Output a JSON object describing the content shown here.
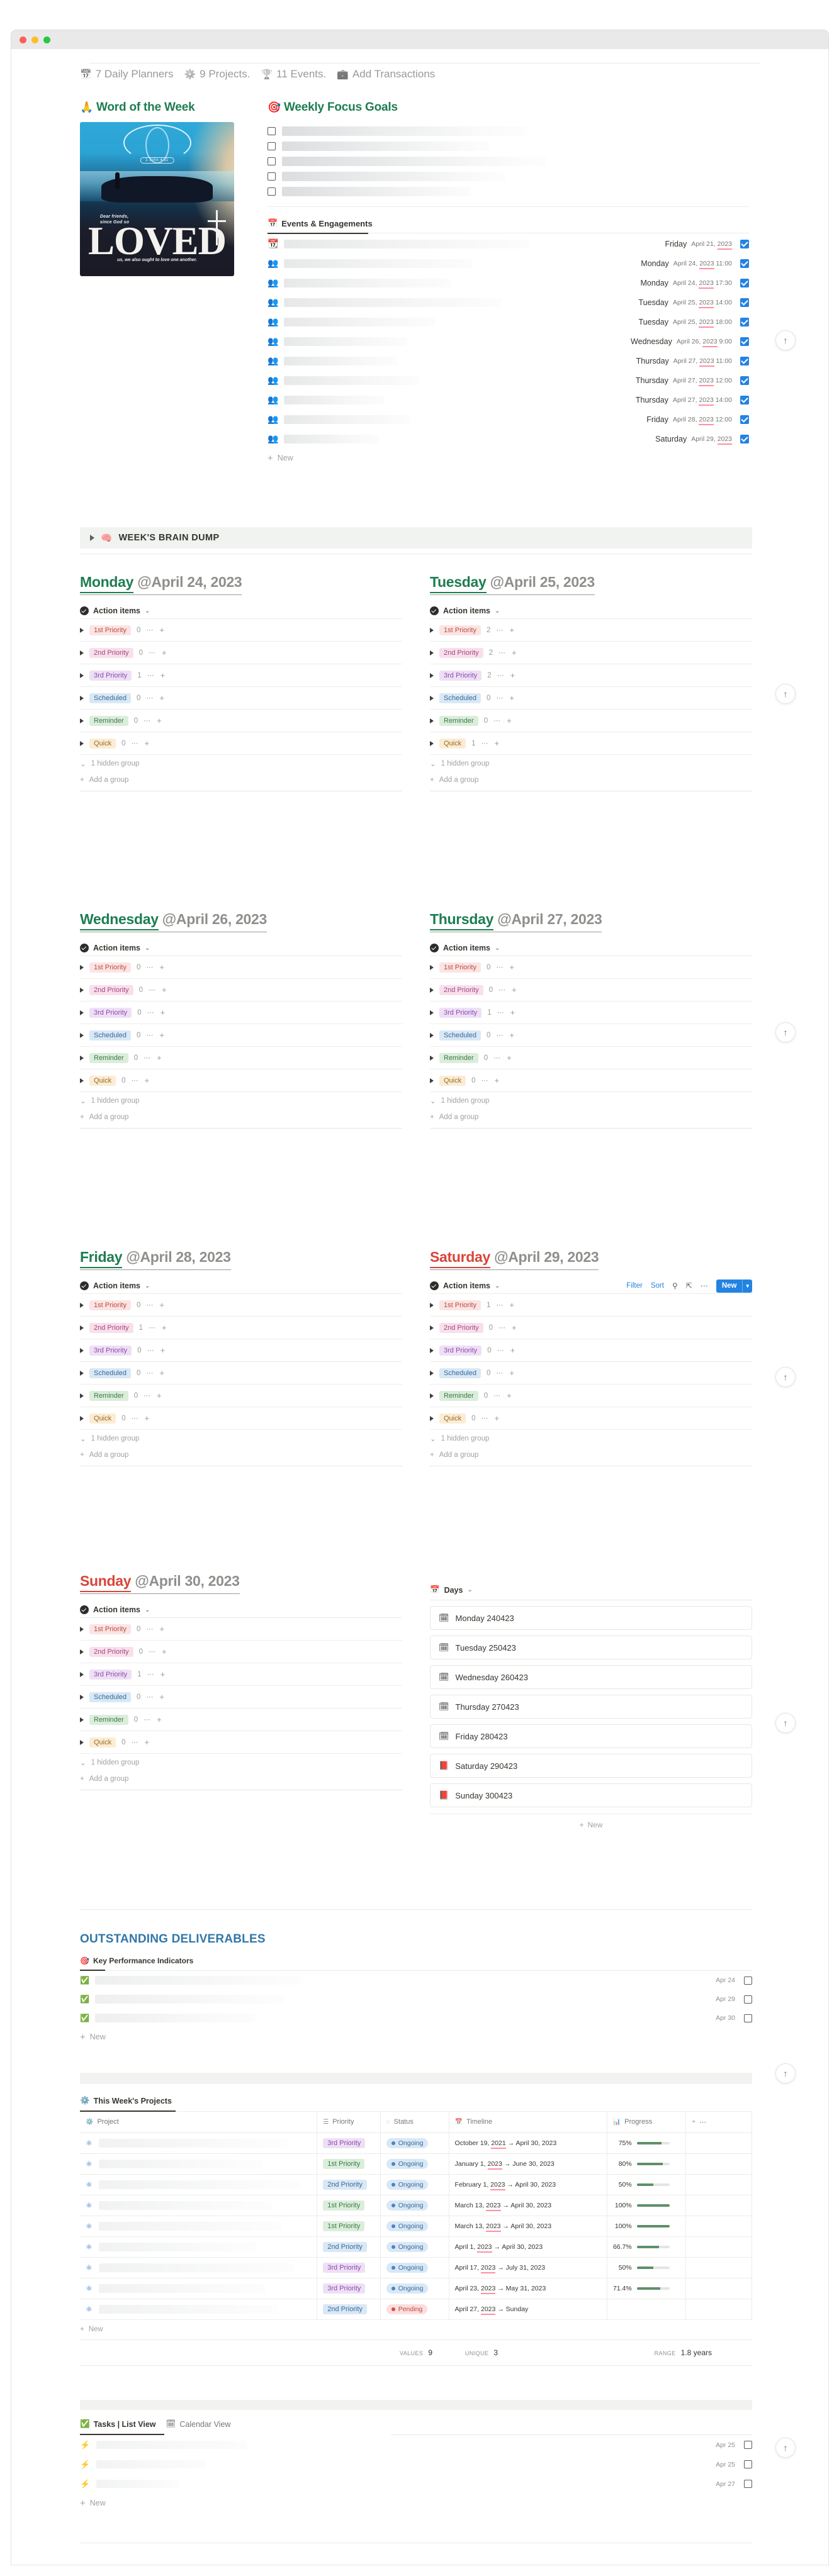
{
  "window": {
    "traffic_lights": [
      "close",
      "minimize",
      "zoom"
    ]
  },
  "breadcrumb": [
    {
      "icon": "calendar-icon",
      "glyph": "📅",
      "label": "7 Daily Planners"
    },
    {
      "icon": "gear-icon",
      "glyph": "⚙️",
      "label": "9 Projects."
    },
    {
      "icon": "trophy-icon",
      "glyph": "🏆",
      "label": "11 Events."
    },
    {
      "icon": "briefcase-icon",
      "glyph": "💼",
      "label": "Add Transactions"
    }
  ],
  "word_of_week": {
    "heading": "Word of the Week",
    "heading_emoji": "🙏",
    "poster": {
      "main_word": "LOVED",
      "top_text": "Dear friends,\nsince God so",
      "bottom_text": "us, we also ought to love one another.",
      "verse_ref": "1 John 4:11"
    }
  },
  "weekly_focus_goals": {
    "heading": "Weekly Focus Goals",
    "heading_emoji": "🎯",
    "rows": [
      {
        "checked": false,
        "redacted_class": "r-g1"
      },
      {
        "checked": false,
        "redacted_class": "r-g2"
      },
      {
        "checked": false,
        "redacted_class": "r-g3"
      },
      {
        "checked": false,
        "redacted_class": "r-g4"
      },
      {
        "checked": false,
        "redacted_class": "r-g5"
      }
    ]
  },
  "events": {
    "tab_label": "Events & Engagements",
    "tab_emoji": "📅",
    "new_label": "New",
    "rows": [
      {
        "icon_emoji": "📆",
        "day": "Friday",
        "date": "April 21, ",
        "year": "2023",
        "time": "",
        "checked": true,
        "rw": 390
      },
      {
        "icon_emoji": "👥",
        "day": "Monday",
        "date": "April 24, ",
        "year": "2023",
        "time": " 11:00",
        "checked": true,
        "rw": 300
      },
      {
        "icon_emoji": "👥",
        "day": "Monday",
        "date": "April 24, ",
        "year": "2023",
        "time": " 17:30",
        "checked": true,
        "rw": 265
      },
      {
        "icon_emoji": "👥",
        "day": "Tuesday",
        "date": "April 25, ",
        "year": "2023",
        "time": " 14:00",
        "checked": true,
        "rw": 345
      },
      {
        "icon_emoji": "👥",
        "day": "Tuesday",
        "date": "April 25, ",
        "year": "2023",
        "time": " 18:00",
        "checked": true,
        "rw": 240
      },
      {
        "icon_emoji": "👥",
        "day": "Wednesday",
        "date": "April 26, ",
        "year": "2023",
        "time": " 9:00",
        "checked": true,
        "rw": 195
      },
      {
        "icon_emoji": "👥",
        "day": "Thursday",
        "date": "April 27, ",
        "year": "2023",
        "time": " 11:00",
        "checked": true,
        "rw": 180
      },
      {
        "icon_emoji": "👥",
        "day": "Thursday",
        "date": "April 27, ",
        "year": "2023",
        "time": " 12:00",
        "checked": true,
        "rw": 215
      },
      {
        "icon_emoji": "👥",
        "day": "Thursday",
        "date": "April 27, ",
        "year": "2023",
        "time": " 14:00",
        "checked": true,
        "rw": 160
      },
      {
        "icon_emoji": "👥",
        "day": "Friday",
        "date": "April 28, ",
        "year": "2023",
        "time": " 12:00",
        "checked": true,
        "rw": 200
      },
      {
        "icon_emoji": "👥",
        "day": "Saturday",
        "date": "April 29, ",
        "year": "2023",
        "time": "",
        "checked": true,
        "rw": 150
      }
    ]
  },
  "brain_dump": {
    "label": "WEEK'S BRAIN DUMP",
    "emoji": "🧠"
  },
  "day_labels": {
    "action_items": "Action items",
    "hidden_group": "1 hidden group",
    "add_group": "Add a group",
    "filter": "Filter",
    "sort": "Sort",
    "new": "New"
  },
  "days": [
    {
      "name": "Monday",
      "date": "@April 24, 2023",
      "weekend": false,
      "groups": [
        {
          "label": "1st Priority",
          "cls": "p-1st",
          "count": "0"
        },
        {
          "label": "2nd Priority",
          "cls": "p-2nd",
          "count": "0"
        },
        {
          "label": "3rd Priority",
          "cls": "p-3rd",
          "count": "1"
        },
        {
          "label": "Scheduled",
          "cls": "p-sch",
          "count": "0"
        },
        {
          "label": "Reminder",
          "cls": "p-rem",
          "count": "0"
        },
        {
          "label": "Quick",
          "cls": "p-qui",
          "count": "0"
        }
      ]
    },
    {
      "name": "Tuesday",
      "date": "@April 25, 2023",
      "weekend": false,
      "groups": [
        {
          "label": "1st Priority",
          "cls": "p-1st",
          "count": "2"
        },
        {
          "label": "2nd Priority",
          "cls": "p-2nd",
          "count": "2"
        },
        {
          "label": "3rd Priority",
          "cls": "p-3rd",
          "count": "2"
        },
        {
          "label": "Scheduled",
          "cls": "p-sch",
          "count": "0"
        },
        {
          "label": "Reminder",
          "cls": "p-rem",
          "count": "0"
        },
        {
          "label": "Quick",
          "cls": "p-qui",
          "count": "1"
        }
      ]
    },
    {
      "name": "Wednesday",
      "date": "@April 26, 2023",
      "weekend": false,
      "groups": [
        {
          "label": "1st Priority",
          "cls": "p-1st",
          "count": "0"
        },
        {
          "label": "2nd Priority",
          "cls": "p-2nd",
          "count": "0"
        },
        {
          "label": "3rd Priority",
          "cls": "p-3rd",
          "count": "0"
        },
        {
          "label": "Scheduled",
          "cls": "p-sch",
          "count": "0"
        },
        {
          "label": "Reminder",
          "cls": "p-rem",
          "count": "0"
        },
        {
          "label": "Quick",
          "cls": "p-qui",
          "count": "0"
        }
      ]
    },
    {
      "name": "Thursday",
      "date": "@April 27, 2023",
      "weekend": false,
      "groups": [
        {
          "label": "1st Priority",
          "cls": "p-1st",
          "count": "0"
        },
        {
          "label": "2nd Priority",
          "cls": "p-2nd",
          "count": "0"
        },
        {
          "label": "3rd Priority",
          "cls": "p-3rd",
          "count": "1"
        },
        {
          "label": "Scheduled",
          "cls": "p-sch",
          "count": "0"
        },
        {
          "label": "Reminder",
          "cls": "p-rem",
          "count": "0"
        },
        {
          "label": "Quick",
          "cls": "p-qui",
          "count": "0"
        }
      ]
    },
    {
      "name": "Friday",
      "date": "@April 28, 2023",
      "weekend": false,
      "groups": [
        {
          "label": "1st Priority",
          "cls": "p-1st",
          "count": "0"
        },
        {
          "label": "2nd Priority",
          "cls": "p-2nd",
          "count": "1"
        },
        {
          "label": "3rd Priority",
          "cls": "p-3rd",
          "count": "0"
        },
        {
          "label": "Scheduled",
          "cls": "p-sch",
          "count": "0"
        },
        {
          "label": "Reminder",
          "cls": "p-rem",
          "count": "0"
        },
        {
          "label": "Quick",
          "cls": "p-qui",
          "count": "0"
        }
      ]
    },
    {
      "name": "Saturday",
      "date": "@April 29, 2023",
      "weekend": true,
      "toolbar": true,
      "groups": [
        {
          "label": "1st Priority",
          "cls": "p-1st",
          "count": "1"
        },
        {
          "label": "2nd Priority",
          "cls": "p-2nd",
          "count": "0"
        },
        {
          "label": "3rd Priority",
          "cls": "p-3rd",
          "count": "0"
        },
        {
          "label": "Scheduled",
          "cls": "p-sch",
          "count": "0"
        },
        {
          "label": "Reminder",
          "cls": "p-rem",
          "count": "0"
        },
        {
          "label": "Quick",
          "cls": "p-qui",
          "count": "0"
        }
      ]
    },
    {
      "name": "Sunday",
      "date": "@April 30, 2023",
      "weekend": true,
      "groups": [
        {
          "label": "1st Priority",
          "cls": "p-1st",
          "count": "0"
        },
        {
          "label": "2nd Priority",
          "cls": "p-2nd",
          "count": "0"
        },
        {
          "label": "3rd Priority",
          "cls": "p-3rd",
          "count": "1"
        },
        {
          "label": "Scheduled",
          "cls": "p-sch",
          "count": "0"
        },
        {
          "label": "Reminder",
          "cls": "p-rem",
          "count": "0"
        },
        {
          "label": "Quick",
          "cls": "p-qui",
          "count": "0"
        }
      ]
    }
  ],
  "days_list": {
    "header": "Days",
    "header_emoji": "📅",
    "new_label": "New",
    "items": [
      {
        "emoji": "🗓",
        "label": "Monday 240423"
      },
      {
        "emoji": "🗓",
        "label": "Tuesday 250423"
      },
      {
        "emoji": "🗓",
        "label": "Wednesday 260423"
      },
      {
        "emoji": "🗓",
        "label": "Thursday 270423"
      },
      {
        "emoji": "🗓",
        "label": "Friday 280423"
      },
      {
        "emoji": "📕",
        "label": "Saturday 290423"
      },
      {
        "emoji": "📕",
        "label": "Sunday 300423"
      }
    ]
  },
  "outstanding": {
    "title": "OUTSTANDING DELIVERABLES",
    "tab_label": "Key Performance Indicators",
    "tab_emoji": "🎯",
    "new_label": "New",
    "rows": [
      {
        "date": "Apr 24",
        "rw": 330
      },
      {
        "date": "Apr 29",
        "rw": 300
      },
      {
        "date": "Apr 30",
        "rw": 255
      }
    ]
  },
  "projects": {
    "tab_label": "This Week's Projects",
    "tab_emoji": "⚙️",
    "new_label": "New",
    "columns": [
      "Project",
      "Priority",
      "Status",
      "Timeline",
      "Progress"
    ],
    "column_icons": [
      "gear-icon",
      "bars-icon",
      "loading-icon",
      "calendar-icon",
      "chart-icon"
    ],
    "rows": [
      {
        "rw": 300,
        "priority": "3rd Priority",
        "pcls": "p-3rd",
        "status": "Ongoing",
        "scls": "st-ongoing",
        "t_pre": "October 19, ",
        "t_year": "2021",
        "t_post": " → April 30, 2023",
        "progress": "75%",
        "pct": 75
      },
      {
        "rw": 260,
        "priority": "1st Priority",
        "pcls": "p-1stg",
        "status": "Ongoing",
        "scls": "st-ongoing",
        "t_pre": "January 1, ",
        "t_year": "2023",
        "t_post": " → June 30, 2023",
        "progress": "80%",
        "pct": 80
      },
      {
        "rw": 320,
        "priority": "2nd Priority",
        "pcls": "p-sch",
        "status": "Ongoing",
        "scls": "st-ongoing",
        "t_pre": "February 1, ",
        "t_year": "2023",
        "t_post": " → April 30, 2023",
        "progress": "50%",
        "pct": 50
      },
      {
        "rw": 275,
        "priority": "1st Priority",
        "pcls": "p-1stg",
        "status": "Ongoing",
        "scls": "st-ongoing",
        "t_pre": "March 13, ",
        "t_year": "2023",
        "t_post": " → April 30, 2023",
        "progress": "100%",
        "pct": 100
      },
      {
        "rw": 290,
        "priority": "1st Priority",
        "pcls": "p-1stg",
        "status": "Ongoing",
        "scls": "st-ongoing",
        "t_pre": "March 13, ",
        "t_year": "2023",
        "t_post": " → April 30, 2023",
        "progress": "100%",
        "pct": 100
      },
      {
        "rw": 250,
        "priority": "2nd Priority",
        "pcls": "p-sch",
        "status": "Ongoing",
        "scls": "st-ongoing",
        "t_pre": "April 1, ",
        "t_year": "2023",
        "t_post": " → April 30, 2023",
        "progress": "66.7%",
        "pct": 67
      },
      {
        "rw": 310,
        "priority": "3rd Priority",
        "pcls": "p-3rd",
        "status": "Ongoing",
        "scls": "st-ongoing",
        "t_pre": "April 17, ",
        "t_year": "2023",
        "t_post": " → July 31, 2023",
        "progress": "50%",
        "pct": 50
      },
      {
        "rw": 265,
        "priority": "3rd Priority",
        "pcls": "p-3rd",
        "status": "Ongoing",
        "scls": "st-ongoing",
        "t_pre": "April 23, ",
        "t_year": "2023",
        "t_post": " → May 31, 2023",
        "progress": "71.4%",
        "pct": 71
      },
      {
        "rw": 285,
        "priority": "2nd Priority",
        "pcls": "p-sch",
        "status": "Pending",
        "scls": "st-pending",
        "t_pre": "April 27, ",
        "t_year": "2023",
        "t_post": " → Sunday",
        "progress": "",
        "pct": 0
      }
    ],
    "aggregates": [
      {
        "label": "VALUES",
        "value": "9"
      },
      {
        "label": "UNIQUE",
        "value": "3"
      },
      {
        "label": "RANGE",
        "value": "1.8 years"
      }
    ]
  },
  "tasks": {
    "tab_list_label": "Tasks | List View",
    "tab_list_emoji": "✅",
    "tab_calendar_label": "Calendar View",
    "tab_calendar_emoji": "🗓",
    "new_label": "New",
    "rows": [
      {
        "bolt": "⚡",
        "date": "Apr 25",
        "rw": 240
      },
      {
        "bolt": "⚡",
        "date": "Apr 25",
        "rw": 175
      },
      {
        "bolt": "⚡",
        "date": "Apr 27",
        "rw": 130
      }
    ]
  },
  "back_to_top": {
    "glyph": "↑",
    "count": 6
  }
}
